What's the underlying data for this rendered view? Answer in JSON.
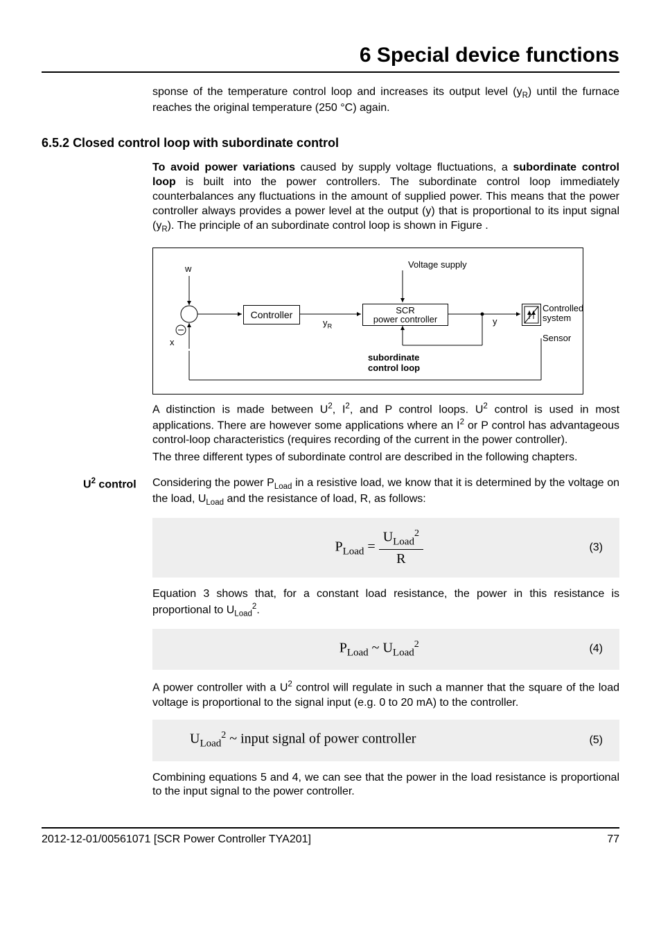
{
  "chapter": "6 Special device functions",
  "intro": {
    "line1_a": "sponse of the temperature control loop and increases its output level (y",
    "line1_sub": "R",
    "line1_b": ") until the furnace reaches the original temperature (250 °C) again."
  },
  "section": {
    "number": "6.5.2",
    "title": "Closed control loop with subordinate control"
  },
  "p1": {
    "a": "To avoid power variations",
    "b": " caused by supply voltage fluctuations, a ",
    "c": "subordinate control loop",
    "d": " is built into the power controllers. The subordinate control loop immediately counterbalances any fluctuations in the amount of supplied power. This means that the power controller always provides a power level at the output (y) that is proportional to its input signal (y",
    "sub": "R",
    "e": "). The principle of an subordinate control loop is shown in Figure ."
  },
  "diagram": {
    "w": "w",
    "x": "x",
    "controller": "Controller",
    "yR": "y",
    "yR_sub": "R",
    "scr_l1": "SCR",
    "scr_l2": "power controller",
    "voltage_supply": "Voltage supply",
    "y": "y",
    "controlled_l1": "Controlled",
    "controlled_l2": "system",
    "sensor": "Sensor",
    "sub_l1": "subordinate",
    "sub_l2": "control loop"
  },
  "p2": {
    "a": "A distinction is made between U",
    "b": ", I",
    "c": ", and P control loops. U",
    "d": " control is used in most applications. There are however some applications where an I",
    "e": " or P control has advantageous control-loop characteristics (requires recording of the current in the power controller).",
    "f": "The three different types of subordinate control are described in the following chapters.",
    "sup": "2"
  },
  "side_u2": {
    "a": "U",
    "sup": "2",
    "b": " control"
  },
  "p3": {
    "a": "Considering the power P",
    "sub1": "Load",
    "b": " in a resistive load, we know that it is determined by the voltage on the load, U",
    "sub2": "Load",
    "c": " and the resistance of load, R, as follows:"
  },
  "eq3": {
    "PLoad": "P",
    "P_sub": "Load",
    "eq": " = ",
    "U": "U",
    "U_sub": "Load",
    "sup": "2",
    "R": "R",
    "num": "(3)"
  },
  "p4": {
    "a": "Equation 3 shows that, for a constant load resistance, the power in this resistance is proportional to U",
    "sub": "Load",
    "sup": "2",
    "b": "."
  },
  "eq4": {
    "P": "P",
    "sub": "Load",
    "tilde": " ~ ",
    "U": "U",
    "sup": "2",
    "num": "(4)"
  },
  "p5": {
    "a": "A power controller with a U",
    "sup": "2",
    "b": " control will regulate in such a manner that the square of the load voltage is proportional to the signal input (e.g. 0 to 20 mA) to the controller."
  },
  "eq5": {
    "U": "U",
    "sub": "Load",
    "sup": "2",
    "text": " ~ input signal of power controller",
    "num": "(5)"
  },
  "p6": "Combining equations 5 and 4, we can see that the power in the load resistance is proportional to the input signal to the power controller.",
  "footer": {
    "left": "2012-12-01/00561071 [SCR Power Controller TYA201]",
    "right": "77"
  }
}
